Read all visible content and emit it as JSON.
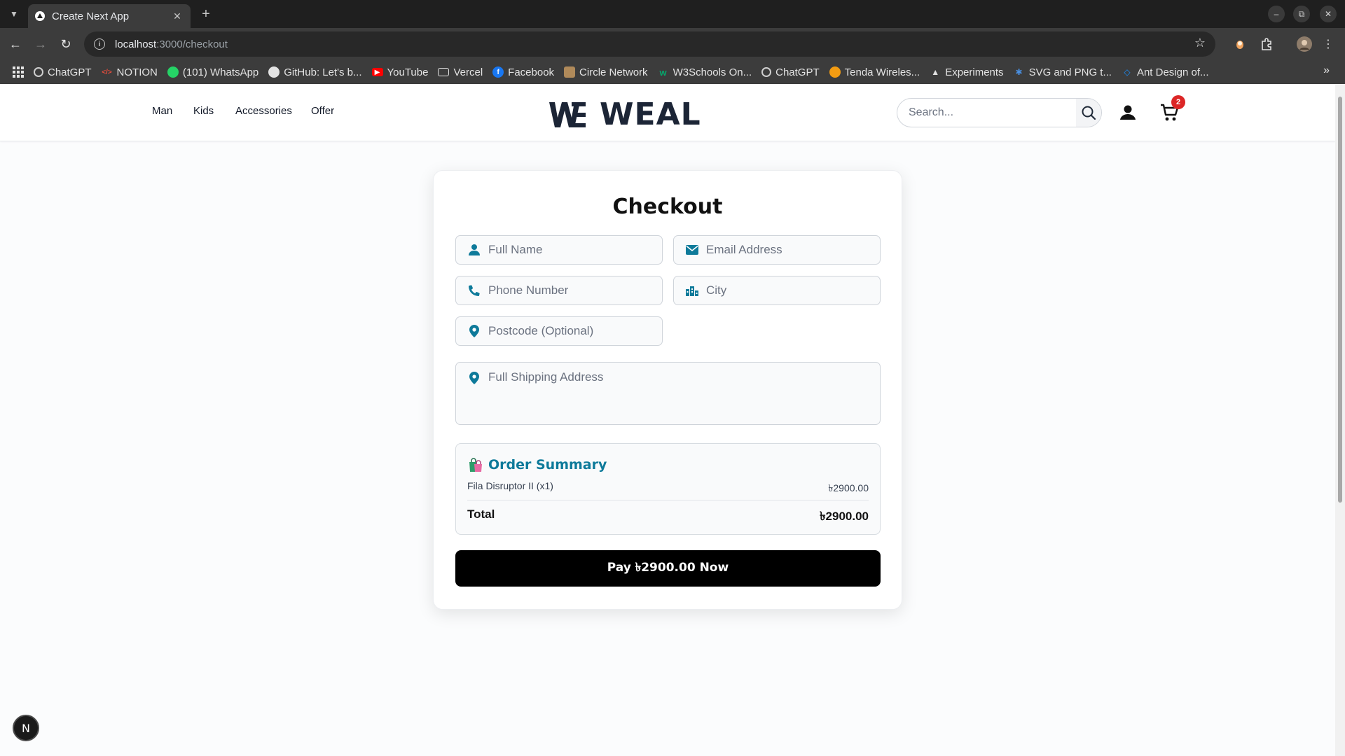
{
  "browser": {
    "tab_title": "Create Next App",
    "url_host": "localhost",
    "url_rest": ":3000/checkout",
    "bookmarks": [
      {
        "label": "ChatGPT",
        "icon": "chatgpt-icon",
        "color": "#cfcfcf"
      },
      {
        "label": "NOTION",
        "icon": "code-icon",
        "color": "#e74c3c"
      },
      {
        "label": "(101) WhatsApp",
        "icon": "whatsapp-icon",
        "color": "#25d366"
      },
      {
        "label": "GitHub: Let's b...",
        "icon": "github-icon",
        "color": "#e3e3e3"
      },
      {
        "label": "YouTube",
        "icon": "youtube-icon",
        "color": "#ff0000"
      },
      {
        "label": "Vercel",
        "icon": "folder-icon",
        "color": "#e3e3e3"
      },
      {
        "label": "Facebook",
        "icon": "facebook-icon",
        "color": "#1877f2"
      },
      {
        "label": "Circle Network",
        "icon": "circle-network-icon",
        "color": "#b08a5a"
      },
      {
        "label": "W3Schools On...",
        "icon": "w3schools-icon",
        "color": "#04aa6d"
      },
      {
        "label": "ChatGPT",
        "icon": "chatgpt-icon",
        "color": "#cfcfcf"
      },
      {
        "label": "Tenda Wireles...",
        "icon": "tenda-icon",
        "color": "#f39c12"
      },
      {
        "label": "Experiments",
        "icon": "flask-icon",
        "color": "#e3e3e3"
      },
      {
        "label": "SVG and PNG t...",
        "icon": "svg-icon",
        "color": "#4a90e2"
      },
      {
        "label": "Ant Design of...",
        "icon": "antdesign-icon",
        "color": "#1890ff"
      }
    ]
  },
  "header": {
    "nav": [
      "Man",
      "Kids",
      "Accessories",
      "Offer"
    ],
    "logo_text": "WEAL",
    "search_placeholder": "Search...",
    "cart_count": "2"
  },
  "checkout": {
    "title": "Checkout",
    "fields": {
      "full_name": "Full Name",
      "email": "Email Address",
      "phone": "Phone Number",
      "city": "City",
      "postcode": "Postcode (Optional)",
      "address": "Full Shipping Address"
    },
    "summary": {
      "title": "Order Summary",
      "items": [
        {
          "name": "Fila Disruptor II (x1)",
          "price": "৳2900.00"
        }
      ],
      "total_label": "Total",
      "total_value": "৳2900.00"
    },
    "pay_button": "Pay ৳2900.00 Now"
  },
  "dev_badge": "N",
  "colors": {
    "accent": "#0e7a9a",
    "logo": "#1c2536",
    "badge": "#dc2626",
    "button": "#000000"
  }
}
